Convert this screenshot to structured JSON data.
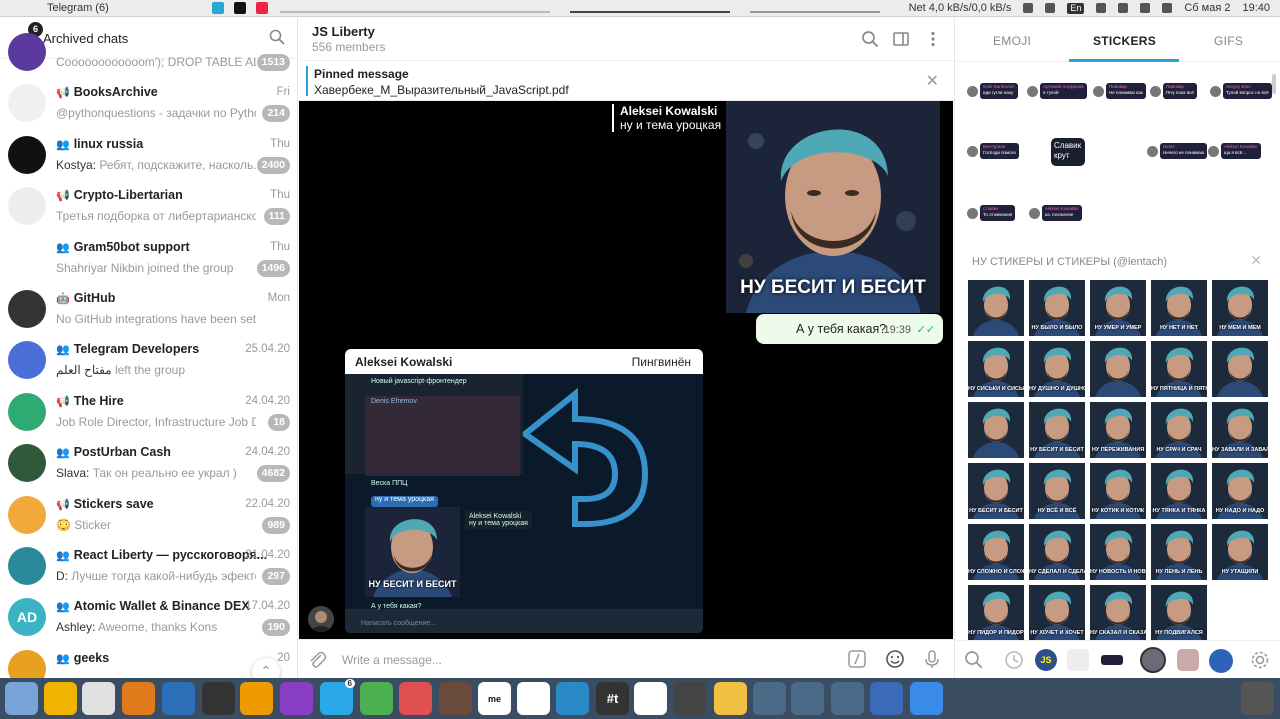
{
  "system_bar": {
    "window_title": "Telegram (6)",
    "net_speed": "Net 4,0 kB/s/0,0 kB/s",
    "lang": "En",
    "date": "Сб мая 2",
    "time": "19:40"
  },
  "sidebar": {
    "header_badge": "6",
    "title": "Archived chats",
    "chats": [
      {
        "name": "",
        "preview": "Coooooooooooom'); DROP TABLE ALL; ...",
        "sender": "",
        "date": "",
        "count": "1513",
        "kind": "",
        "avatar_color": "#5b3aa0",
        "avatar_text": ""
      },
      {
        "name": "BooksArchive",
        "preview": "@pythonquestions - задачки по Python...",
        "sender": "",
        "date": "Fri",
        "count": "214",
        "kind": "channel",
        "avatar_color": "#f0f0f0",
        "avatar_text": ""
      },
      {
        "name": "linux russia",
        "preview": "Ребят, подскажите, насколь...",
        "sender": "Kostya:",
        "date": "Thu",
        "count": "2400",
        "kind": "group",
        "avatar_color": "#111111",
        "avatar_text": ""
      },
      {
        "name": "Crypto-Libertarian",
        "preview": "Третья подборка от либертарианског...",
        "sender": "",
        "date": "Thu",
        "count": "111",
        "kind": "channel",
        "avatar_color": "#eeeeee",
        "avatar_text": ""
      },
      {
        "name": "Gram50bot support",
        "preview": "Shahriyar Nikbin joined the group",
        "sender": "",
        "date": "Thu",
        "count": "1496",
        "kind": "group",
        "avatar_color": "#ffffff",
        "avatar_text": ""
      },
      {
        "name": "GitHub",
        "preview": "No GitHub integrations have been set up wit...",
        "sender": "",
        "date": "Mon",
        "count": "",
        "kind": "bot",
        "avatar_color": "#333333",
        "avatar_text": ""
      },
      {
        "name": "Telegram Developers",
        "preview": "left the group",
        "sender": "مفتاح العلم",
        "date": "25.04.20",
        "count": "",
        "kind": "group",
        "avatar_color": "#4a6fd8",
        "avatar_text": ""
      },
      {
        "name": "The Hire",
        "preview": "Job Role Director, Infrastructure  Job Det...",
        "sender": "",
        "date": "24.04.20",
        "count": "18",
        "kind": "channel",
        "avatar_color": "#2eaa72",
        "avatar_text": ""
      },
      {
        "name": "PostUrban Cash",
        "preview": "Так он реально ее украл )",
        "sender": "Slava:",
        "date": "24.04.20",
        "count": "4682",
        "kind": "group",
        "avatar_color": "#2e5a3a",
        "avatar_text": ""
      },
      {
        "name": "Stickers save",
        "preview": "Sticker",
        "sender": "😳",
        "date": "22.04.20",
        "count": "989",
        "kind": "channel",
        "avatar_color": "#f2a93b",
        "avatar_text": ""
      },
      {
        "name": "React Liberty — русскоговоря...",
        "preview": "Лучше тогда какой-нибудь эфектор",
        "sender": "D:",
        "date": "21.04.20",
        "count": "297",
        "kind": "group",
        "avatar_color": "#2a8a9a",
        "avatar_text": ""
      },
      {
        "name": "Atomic Wallet & Binance DEX",
        "preview": "Aweome, thanks Kons",
        "sender": "Ashley:",
        "date": "17.04.20",
        "count": "190",
        "kind": "group",
        "avatar_color": "#3bb3c3",
        "avatar_text": "AD"
      },
      {
        "name": "geeks",
        "preview": "",
        "sender": "",
        "date": "20",
        "count": "",
        "kind": "group",
        "avatar_color": "#e8a020",
        "avatar_text": ""
      }
    ]
  },
  "chat": {
    "title": "JS Liberty",
    "members": "556 members",
    "pinned_label": "Pinned message",
    "pinned_text": "Хавербеке_М_Выразительный_JavaScript.pdf",
    "reply_author": "Aleksei Kowalski",
    "reply_text": "ну и тема уроцкая",
    "sticker_caption": "НУ БЕСИТ И БЕСИТ",
    "outgoing_text": "А у тебя какая?",
    "outgoing_time": "19:39",
    "photo_author": "Aleksei Kowalski",
    "photo_forward": "Пингвинён",
    "photo_inner": {
      "preview_author": "Aleksei Kowalski",
      "preview_reply": "ну и тема уроцкая",
      "preview_caption": "НУ БЕСИТ И БЕСИТ",
      "preview_out": "А у тебя какая?",
      "preview_input": "Написать сообщение...",
      "line1": "Новый javascript-фронтендер",
      "line2": "Denis Efremov",
      "line3": "Веска ППЦ",
      "line4": "ну и тема уроцкая"
    },
    "composer_placeholder": "Write a message..."
  },
  "sticker_panel": {
    "tabs": [
      "EMOJI",
      "STICKERS",
      "GIFS"
    ],
    "active_tab": "STICKERS",
    "recent": [
      {
        "name": "Ilook Bankovich",
        "text": "иди гугли наху"
      },
      {
        "name": "Артемий Ануфриев",
        "text": "я тупой"
      },
      {
        "name": "Пивовар",
        "text": "Не понимаю как"
      },
      {
        "name": "Пивовар",
        "text": "ПНу пока всё"
      },
      {
        "name": "Sergey Etov",
        "text": "Тупой вопрос но всё"
      },
      {
        "name": "Вентуриан",
        "text": "Господи помоги"
      },
      {
        "name": "Славик",
        "text": "крут"
      },
      {
        "name": "Denis",
        "text": "Ничего не понимаю"
      },
      {
        "name": "Aleksei Kowalski",
        "text": "ща я всё..."
      },
      {
        "name": "Славик",
        "text": "То отжимания"
      },
      {
        "name": "Aleksei Kowalski",
        "text": "аз. госиналне"
      }
    ],
    "set_title": "НУ СТИКЕРЫ И СТИКЕРЫ (@lentach)",
    "stickers": [
      "",
      "НУ БЫЛО И БЫЛО",
      "НУ УМЕР И УМЕР",
      "НУ НЕТ И НЕТ",
      "НУ МЕМ И МЕМ",
      "НУ СИСЬКИ И СИСЬКИ",
      "НУ ДУШНО И ДУШНО",
      "",
      "НУ ПЯТНИЦА И ПЯТНИЦА",
      "",
      "",
      "НУ БЕСИТ И БЕСИТ",
      "НУ ПЕРЕЖИВАНИЯ",
      "НУ СРАЧ И СРАЧ",
      "НУ ЗАВАЛИ И ЗАВАЛИ",
      "НУ БЕСИТ И БЕСИТ",
      "НУ ВСЁ И ВСЁ",
      "НУ КОТИК И КОТИК",
      "НУ ТЯНКА И ТЯНКА",
      "НУ НАДО И НАДО",
      "НУ СЛОЖНО И СЛОЖНО",
      "НУ СДЕЛАЛ И СДЕЛАЛ",
      "НУ НОВОСТЬ И НОВОСТЬ",
      "НУ ЛЕНЬ И ЛЕНЬ",
      "НУ УТАЩИЛИ",
      "НУ ПИДОР И ПИДОР",
      "НУ ХОЧЕТ И ХОЧЕТ",
      "НУ СКАЗАЛ И СКАЗАЛ",
      "НУ ПОДВИГАЛСЯ"
    ]
  },
  "dock": {
    "apps": [
      "start",
      "files",
      "chrome",
      "sublime",
      "firefox",
      "terminal",
      "email",
      "podcast",
      "telegram",
      "toggle",
      "pomodoro",
      "gimp",
      "me",
      "slack",
      "monitor",
      "t",
      "camera",
      "calc",
      "sketch",
      "qt",
      "qt",
      "qt",
      "remmina",
      "more",
      "trash"
    ],
    "telegram_badge": "6"
  }
}
